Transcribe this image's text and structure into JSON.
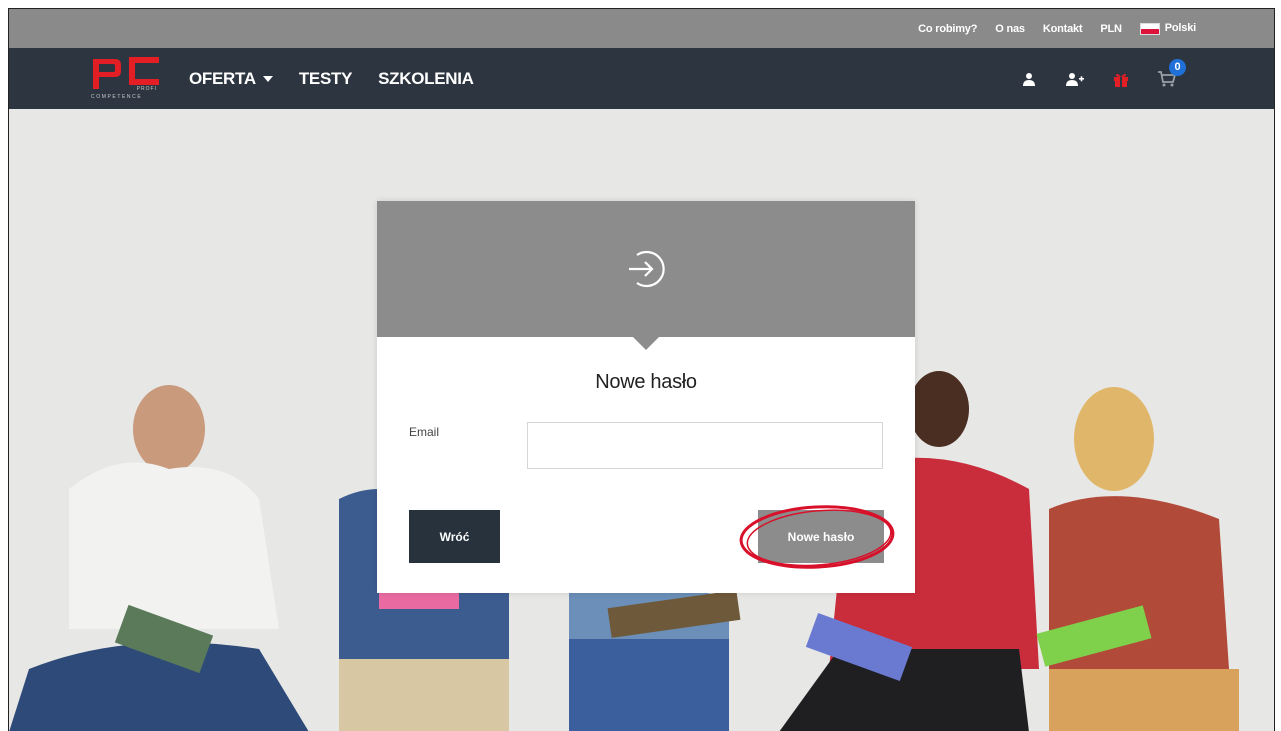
{
  "topbar": {
    "links": [
      "Co robimy?",
      "O nas",
      "Kontakt",
      "PLN"
    ],
    "language": "Polski"
  },
  "nav": {
    "logo_profi": "PROFI",
    "logo_competence": "COMPETENCE",
    "menu": [
      "OFERTA",
      "TESTY",
      "SZKOLENIA"
    ],
    "cart_count": "0"
  },
  "modal": {
    "title": "Nowe hasło",
    "email_label": "Email",
    "email_value": "",
    "back_label": "Wróć",
    "submit_label": "Nowe hasło"
  },
  "colors": {
    "topbar": "#8a8a8a",
    "navbar": "#2c3540",
    "logo_red": "#e31e24",
    "gift_red": "#e31e24",
    "badge_blue": "#1f70d8",
    "annotation_red": "#d8102a"
  },
  "icons": [
    "user-icon",
    "add-user-icon",
    "gift-icon",
    "cart-icon",
    "login-arrow-icon",
    "chevron-down-icon"
  ]
}
